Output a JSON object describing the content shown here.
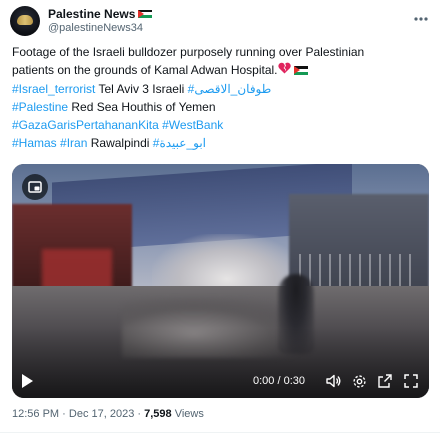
{
  "author": {
    "display_name": "Palestine News",
    "handle": "@palestineNews34"
  },
  "tweet": {
    "line1": "Footage of the Israeli bulldozer purposely running over Palestinian",
    "line2_text": "patients on the grounds of Kamal Adwan Hospital.",
    "line3": {
      "tag1": "#Israel_terrorist",
      "text": "Tel Aviv 3 Israeli",
      "tag2": "#طوفان_الاقصى"
    },
    "line4": {
      "tag": "#Palestine",
      "text": "Red Sea Houthis of Yemen"
    },
    "line5": {
      "tag1": "#GazaGarisPertahananKita",
      "tag2": "#WestBank"
    },
    "line6": {
      "tag1": "#Hamas",
      "tag2": "#Iran",
      "text": "Rawalpindi",
      "tag3": "#ابو_عبيدة"
    }
  },
  "video": {
    "time": "0:00 / 0:30",
    "icons": [
      "play-icon",
      "picture-in-picture-icon",
      "volume-icon",
      "settings-icon",
      "popout-icon",
      "fullscreen-icon"
    ]
  },
  "meta": {
    "time": "12:56 PM",
    "separator1": "·",
    "date": "Dec 17, 2023",
    "separator2": "·",
    "views_count": "7,598",
    "views_label": "Views"
  },
  "colors": {
    "link": "#1d9bf0",
    "text": "#0f1419",
    "muted": "#536471",
    "heart": "#e0245e"
  }
}
